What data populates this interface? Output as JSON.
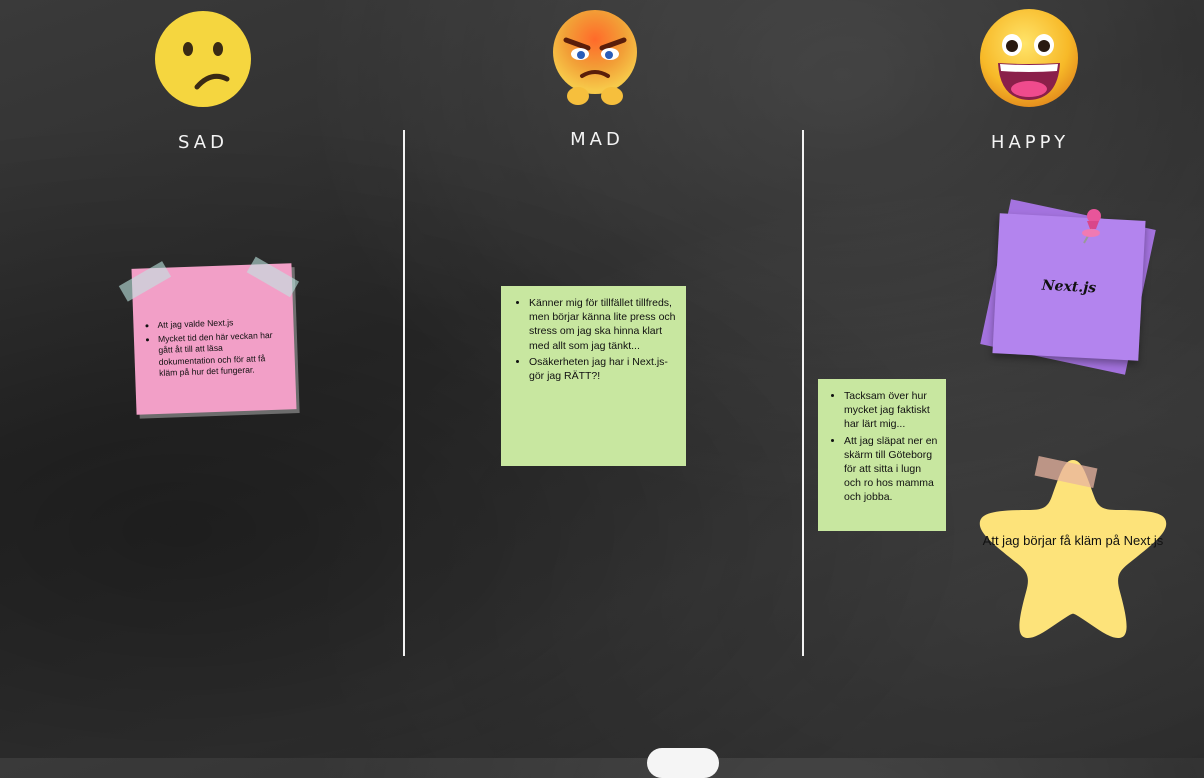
{
  "columns": [
    {
      "title": "SAD",
      "emoji": "confused-face-icon"
    },
    {
      "title": "MAD",
      "emoji": "angry-face-icon"
    },
    {
      "title": "HAPPY",
      "emoji": "grinning-face-icon"
    }
  ],
  "notes": {
    "sad_pink": [
      "Att jag valde Next.js",
      "Mycket tid den här veckan har gått åt till att läsa dokumentation och för att få kläm på hur det fungerar."
    ],
    "mad_green": [
      "Känner mig för tillfället tillfreds, men börjar känna lite press och stress om jag ska hinna klart med allt som jag tänkt...",
      "Osäkerheten jag har i Next.js- gör jag RÄTT?!"
    ],
    "happy_green": [
      "Tacksam över hur mycket jag faktiskt har lärt mig...",
      "Att jag släpat ner en skärm till Göteborg för att sitta i lugn och ro hos mamma och jobba."
    ],
    "happy_purple": "Next.js",
    "happy_star": "Att jag börjar få kläm på Next.js"
  },
  "colors": {
    "pink": "#f29fc7",
    "green": "#c8e7a0",
    "purple": "#b384ee",
    "star": "#fde37a"
  }
}
